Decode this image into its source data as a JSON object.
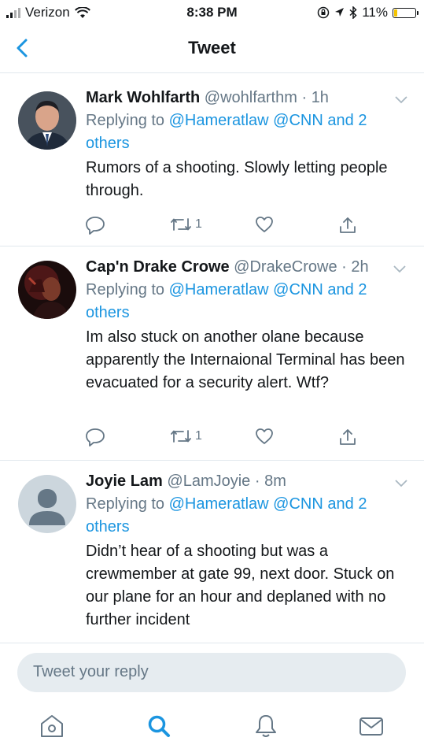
{
  "status_bar": {
    "carrier": "Verizon",
    "time": "8:38 PM",
    "battery": "11%"
  },
  "nav": {
    "title": "Tweet"
  },
  "tweets": [
    {
      "name": "Mark Wohlfarth",
      "handle": "@wohlfarthm",
      "sep": "·",
      "time": "1h",
      "replying_prefix": "Replying to",
      "replying_to": "@Hameratlaw @CNN",
      "and_others": "and 2 others",
      "text": "Rumors of a shooting. Slowly letting people through.",
      "retweets": "1"
    },
    {
      "name": "Cap'n Drake Crowe",
      "handle": "@DrakeCrowe",
      "sep": "·",
      "time": "2h",
      "replying_prefix": "Replying to",
      "replying_to": "@Hameratlaw @CNN",
      "and_others": "and 2 others",
      "text": "Im also stuck on another olane because apparently the Internaional Terminal has been evacuated for a security alert. Wtf?",
      "retweets": "1"
    },
    {
      "name": "Joyie Lam",
      "handle": "@LamJoyie",
      "sep": "·",
      "time": "8m",
      "replying_prefix": "Replying to",
      "replying_to": "@Hameratlaw @CNN",
      "and_others": "and 2 others",
      "text": "Didn’t hear of a shooting but was a crewmember at gate 99, next door. Stuck on our plane for an hour and deplaned with no further incident"
    }
  ],
  "compose": {
    "placeholder": "Tweet your reply"
  },
  "icons": {
    "back": "chevron-left-icon",
    "home": "home-icon",
    "search": "search-icon",
    "notifications": "bell-icon",
    "messages": "mail-icon"
  },
  "colors": {
    "accent": "#1b95e0",
    "text": "#14171a",
    "secondary": "#657786",
    "divider": "#e1e8ed"
  }
}
